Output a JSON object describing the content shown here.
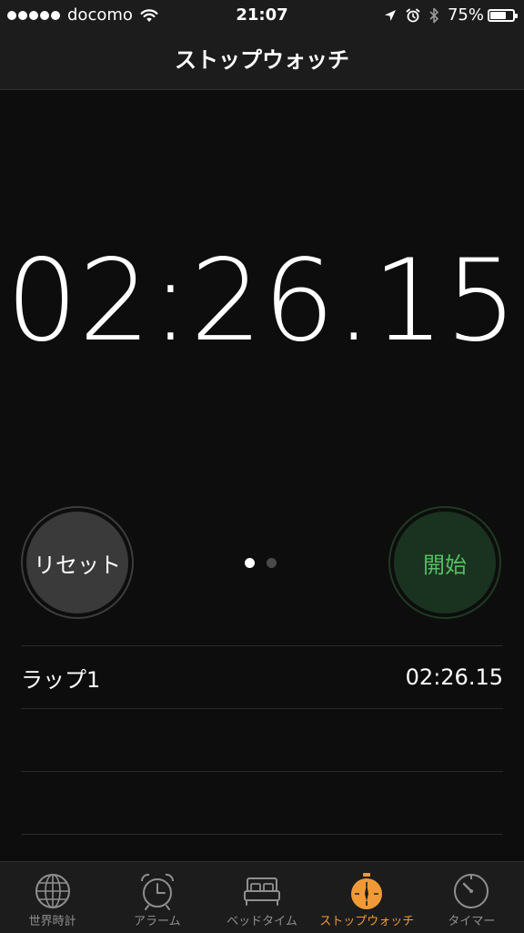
{
  "status_bar": {
    "carrier": "docomo",
    "time": "21:07",
    "battery_percent_text": "75%",
    "battery_level": 0.75,
    "signal_bars": 5,
    "icons": [
      "wifi-icon",
      "location-arrow-icon",
      "alarm-clock-icon",
      "bluetooth-icon",
      "battery-icon"
    ]
  },
  "nav": {
    "title": "ストップウォッチ"
  },
  "timer": {
    "display": "02:26.15"
  },
  "controls": {
    "reset_label": "リセット",
    "start_label": "開始",
    "pages": 2,
    "active_page": 0
  },
  "laps": [
    {
      "label": "ラップ1",
      "time": "02:26.15"
    }
  ],
  "tabs": [
    {
      "label": "世界時計",
      "icon": "globe-icon",
      "active": false
    },
    {
      "label": "アラーム",
      "icon": "alarm-clock-icon",
      "active": false
    },
    {
      "label": "ベッドタイム",
      "icon": "bed-icon",
      "active": false
    },
    {
      "label": "ストップウォッチ",
      "icon": "stopwatch-icon",
      "active": true
    },
    {
      "label": "タイマー",
      "icon": "timer-icon",
      "active": false
    }
  ],
  "colors": {
    "background": "#0d0d0d",
    "bar": "#1c1c1c",
    "accent": "#f09a37",
    "start_text": "#54c163",
    "start_bg": "#1a3320",
    "reset_bg": "#3a3a3a"
  }
}
